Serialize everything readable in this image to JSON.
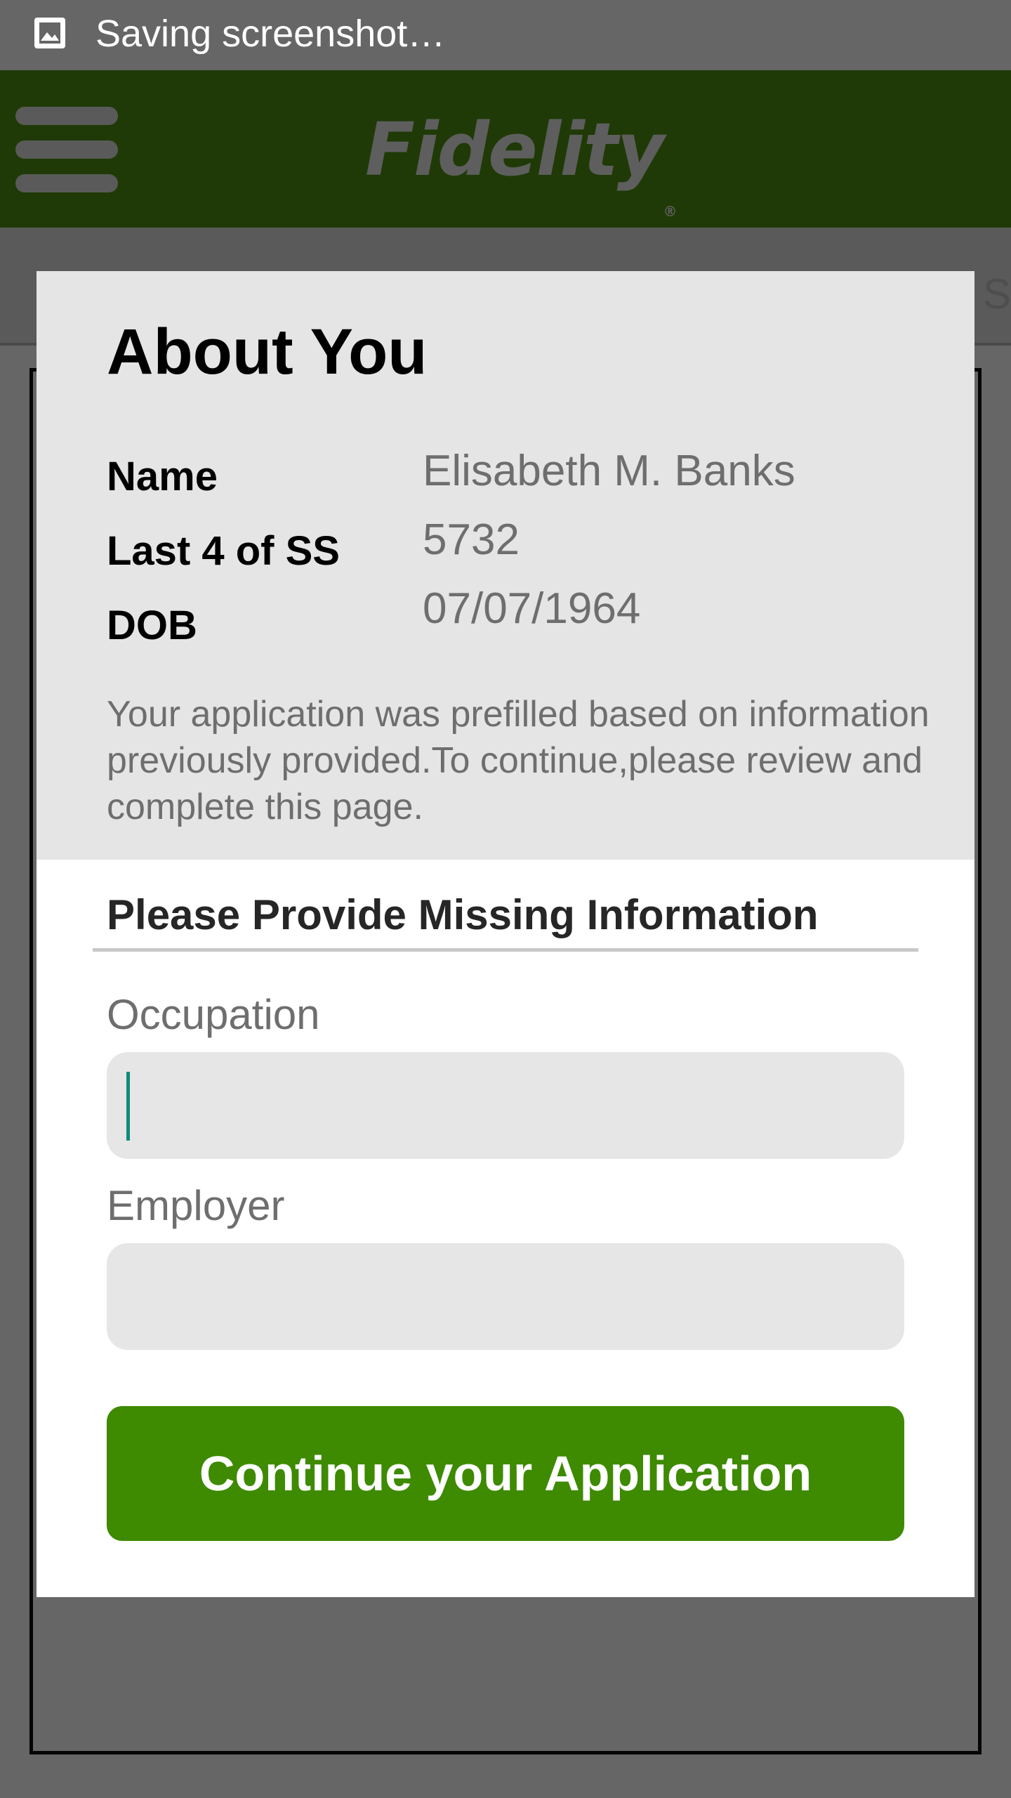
{
  "status_bar": {
    "icon": "image-icon",
    "text": "Saving screenshot…"
  },
  "header": {
    "menu_icon": "hamburger-menu-icon",
    "logo_text": "Fidelity"
  },
  "modal": {
    "title": "About You",
    "info": [
      {
        "label": "Name",
        "value": "Elisabeth M. Banks"
      },
      {
        "label": "Last 4 of SS",
        "value": "5732"
      },
      {
        "label": "DOB",
        "value": "07/07/1964"
      }
    ],
    "prefill_note": "Your application was prefilled based on information previously provided.To continue,please review and complete this page.",
    "section_title": "Please Provide Missing Information",
    "fields": [
      {
        "label": "Occupation",
        "value": "",
        "placeholder": ""
      },
      {
        "label": "Employer",
        "value": "",
        "placeholder": ""
      }
    ],
    "continue_button": "Continue your Application"
  },
  "colors": {
    "header_bg": "#1f3a06",
    "overlay_bg": "#666666",
    "panel_gray": "#e5e5e5",
    "button_green": "#3e8a00",
    "caret_teal": "#118a7a"
  }
}
